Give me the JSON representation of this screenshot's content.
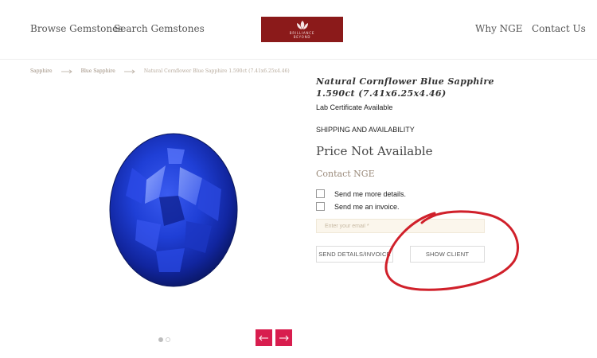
{
  "header": {
    "nav_left": [
      "Browse Gemstones",
      "Search Gemstones"
    ],
    "nav_right": [
      "Why NGE",
      "Contact Us"
    ],
    "logo": {
      "line1": "BRILLIANCE",
      "line2": "BEYOND",
      "color": "#8b1a1a"
    }
  },
  "breadcrumb": {
    "items": [
      "Sapphire",
      "Blue Sapphire",
      "Natural Cornflower Blue Sapphire 1.590ct (7.41x6.25x4.46)"
    ]
  },
  "product": {
    "title": "Natural Cornflower Blue Sapphire 1.590ct (7.41x6.25x4.46)",
    "certificate": "Lab Certificate Available",
    "shipping_heading": "SHIPPING AND AVAILABILITY",
    "price": "Price Not Available",
    "contact_heading": "Contact NGE",
    "image": "blue-sapphire-oval"
  },
  "form": {
    "options": [
      {
        "label": "Send me more details.",
        "checked": false
      },
      {
        "label": "Send me an invoice.",
        "checked": false
      }
    ],
    "email_placeholder": "Enter your email *",
    "email_value": "",
    "send_button": "SEND DETAILS/INVOICE",
    "show_client_button": "SHOW CLIENT"
  },
  "carousel": {
    "dots": 2,
    "active_dot": 0,
    "prev_icon": "arrow-left-icon",
    "next_icon": "arrow-right-icon",
    "button_color": "#d81d4e"
  },
  "annotation": {
    "shape": "hand-drawn-circle",
    "color": "#d0202a"
  }
}
